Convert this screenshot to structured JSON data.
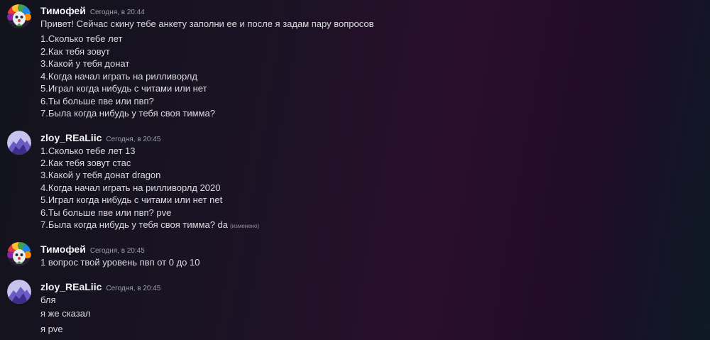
{
  "colors": {
    "username": "#f2f3f5",
    "timestamp": "#9aa0ab",
    "text": "#dcdde1",
    "avatar_purple": "#8a7fd8"
  },
  "messages": [
    {
      "author": "Тимофей",
      "time": "Сегодня, в 20:44",
      "avatar_icon": "rainbow-clown-avatar-icon",
      "lines": [
        "Привет! Сейчас скину тебе анкету заполни ее и после я задам пару вопросов",
        "1.Сколько тебе лет",
        "2.Как тебя зовут",
        "3.Какой у тебя донат",
        "4.Когда начал играть на рилливорлд",
        "5.Играл когда нибудь с читами или нет",
        "6.Ты больше пве или пвп?",
        "7.Была когда нибудь у тебя своя тимма?"
      ]
    },
    {
      "author": "zloy_REaLiic",
      "time": "Сегодня, в 20:45",
      "avatar_icon": "purple-mountain-avatar-icon",
      "lines": [
        "1.Сколько тебе лет 13",
        "2.Как тебя зовут стас",
        "3.Какой у тебя донат dragon",
        "4.Когда начал играть на рилливорлд 2020",
        "5.Играл когда нибудь с читами или нет net",
        "6.Ты больше пве или пвп? pve",
        "7.Была когда нибудь у тебя своя тимма? da"
      ],
      "edited_label": "(изменено)"
    },
    {
      "author": "Тимофей",
      "time": "Сегодня, в 20:45",
      "avatar_icon": "rainbow-clown-avatar-icon",
      "lines": [
        "1 вопрос твой уровень пвп от 0 до 10"
      ]
    },
    {
      "author": "zloy_REaLiic",
      "time": "Сегодня, в 20:45",
      "avatar_icon": "purple-mountain-avatar-icon",
      "lines": [
        "бля",
        "я же сказал",
        "я pve"
      ]
    }
  ]
}
